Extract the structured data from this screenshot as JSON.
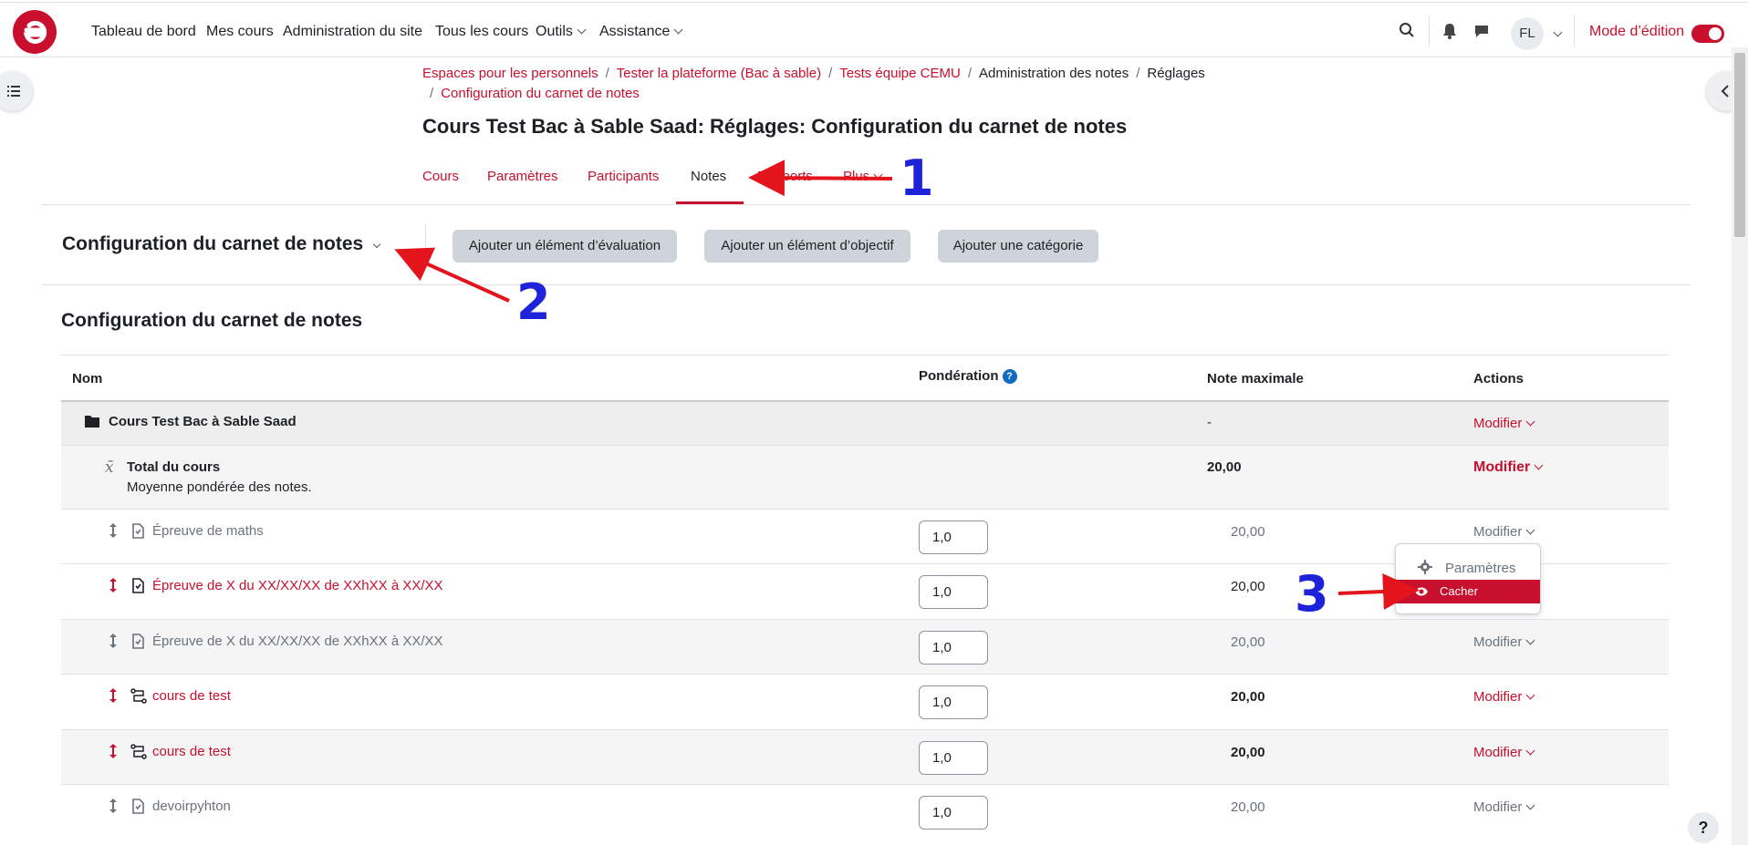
{
  "navbar": {
    "items": [
      "Tableau de bord",
      "Mes cours",
      "Administration du site",
      "Tous les cours",
      "Outils",
      "Assistance"
    ],
    "avatar_initials": "FL",
    "edit_mode_label": "Mode d’édition",
    "edit_mode_on": true,
    "brand_color": "#c8102e"
  },
  "breadcrumb": {
    "items": [
      "Espaces pour les personnels",
      "Tester la plateforme (Bac à sable)",
      "Tests équipe CEMU",
      "Administration des notes",
      "Réglages",
      "Configuration du carnet de notes"
    ]
  },
  "page_title": "Cours Test Bac à Sable Saad: Réglages: Configuration du carnet de notes",
  "tabs": {
    "items": [
      "Cours",
      "Paramètres",
      "Participants",
      "Notes",
      "Rapports",
      "Plus"
    ],
    "active": "Notes"
  },
  "tertiary": {
    "selector_label": "Configuration du carnet de notes",
    "buttons": [
      "Ajouter un élément d’évaluation",
      "Ajouter un élément d’objectif",
      "Ajouter une catégorie"
    ]
  },
  "section_title": "Configuration du carnet de notes",
  "table": {
    "headers": [
      "Nom",
      "Pondération",
      "Note maximale",
      "Actions"
    ],
    "category_row": {
      "name": "Cours Test Bac à Sable Saad",
      "max": "-",
      "action": "Modifier"
    },
    "total_row": {
      "name": "Total du cours",
      "desc": "Moyenne pondérée des notes.",
      "max": "20,00",
      "action": "Modifier"
    },
    "rows": [
      {
        "name": "Épreuve de maths",
        "weight": "1,0",
        "max": "20,00",
        "action": "Modifier",
        "hidden": true,
        "type": "assign"
      },
      {
        "name": "Épreuve de X du XX/XX/XX de XXhXX à XX/XX",
        "weight": "1,0",
        "max": "20,00",
        "action": "Modifier",
        "hidden": false,
        "type": "assign"
      },
      {
        "name": "Épreuve de X du XX/XX/XX de XXhXX à XX/XX",
        "weight": "1,0",
        "max": "20,00",
        "action": "Modifier",
        "hidden": true,
        "type": "assign"
      },
      {
        "name": "cours de test",
        "weight": "1,0",
        "max": "20,00",
        "action": "Modifier",
        "hidden": false,
        "type": "workflow"
      },
      {
        "name": "cours de test",
        "weight": "1,0",
        "max": "20,00",
        "action": "Modifier",
        "hidden": false,
        "type": "workflow"
      },
      {
        "name": "devoirpyhton",
        "weight": "1,0",
        "max": "20,00",
        "action": "Modifier",
        "hidden": true,
        "type": "assign"
      }
    ]
  },
  "action_menu": {
    "items": [
      "Paramètres",
      "Cacher"
    ],
    "selected": "Cacher"
  },
  "annotations": [
    "1",
    "2",
    "3"
  ],
  "help_label": "?"
}
